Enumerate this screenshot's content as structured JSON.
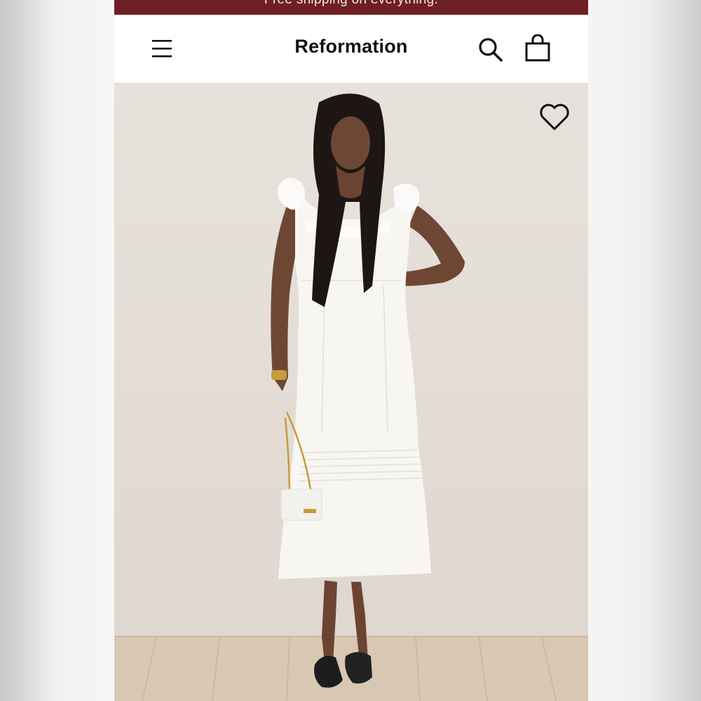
{
  "promo": {
    "text": "Free shipping on everything."
  },
  "header": {
    "brand": "Reformation",
    "menu_icon": "hamburger-menu-icon",
    "search_icon": "search-icon",
    "bag_icon": "shopping-bag-icon"
  },
  "product": {
    "image_alt": "Model wearing a white ruffle-shoulder midi dress",
    "wishlist_icon": "heart-icon"
  },
  "colors": {
    "promo_bg": "#6e1f23",
    "header_bg": "#ffffff",
    "text": "#111111",
    "photo_bg": "#e4ded7"
  }
}
